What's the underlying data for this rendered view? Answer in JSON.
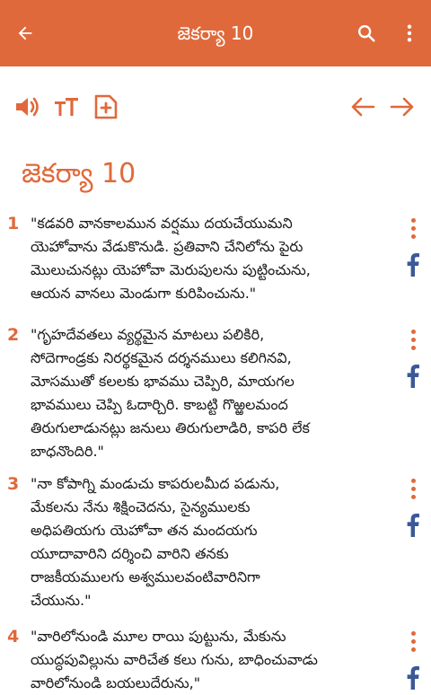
{
  "appbar": {
    "title": "జెకర్యా 10",
    "icons": {
      "back": "arrow-left-icon",
      "search": "search-icon",
      "more": "more-vert-icon"
    }
  },
  "toolbar": {
    "icons": [
      "speaker-icon",
      "text-size-icon",
      "add-note-icon",
      "previous-arrow-icon",
      "next-arrow-icon"
    ]
  },
  "chapter": {
    "title": "జెకర్యా 10"
  },
  "colors": {
    "accent": "#e0693b",
    "facebook": "#3b5998"
  },
  "verses": [
    {
      "number": "1",
      "lines": [
        "\"కడవరి వానకాలమున వర్షము దయచేయుమని",
        "యెహోవాను వేడుకొనుడి. ప్రతివాని చేనిలోను పైరు",
        "మొలుచునట్లు యెహోవా మెరుపులను పుట్టించును,",
        "ఆయన వానలు మెండుగా కురిపించును.\""
      ]
    },
    {
      "number": "2",
      "lines": [
        "\"గృహదేవతలు వ్యర్థమైన మాటలు పలికిరి,",
        "సోదెగాండ్రకు నిరర్థకమైన దర్శనములు కలిగినవి,",
        "మోసముతో కలలకు భావము చెప్పిరి, మాయగల",
        "భావములు చెప్పి ఓదార్చిరి. కాబట్టి గొఱ్ఱలమంద",
        "తిరుగులాడునట్లు జనులు తిరుగులాడిరి, కాపరి లేక",
        "బాధనొందిరి.\""
      ]
    },
    {
      "number": "3",
      "lines": [
        "\"నా కోపాగ్ని మండుచు కాపరులమీద పడును,",
        "మేకలను నేను శిక్షించెదను, సైన్యములకు",
        "అధిపతియగు యెహోవా తన మందయగు",
        "యూదావారిని దర్శించి వారిని తనకు",
        "రాజకీయములగు అశ్వములవంటివారినిగా",
        "చేయును.\""
      ]
    },
    {
      "number": "4",
      "lines": [
        "\"వారిలోనుండి మూల రాయి పుట్టును, మేకును",
        "యుద్ధపువిల్లును వారిచేత కలు గును, బాధించువాడు",
        "వారిలోనుండి బయలుదేరును,\""
      ]
    }
  ]
}
